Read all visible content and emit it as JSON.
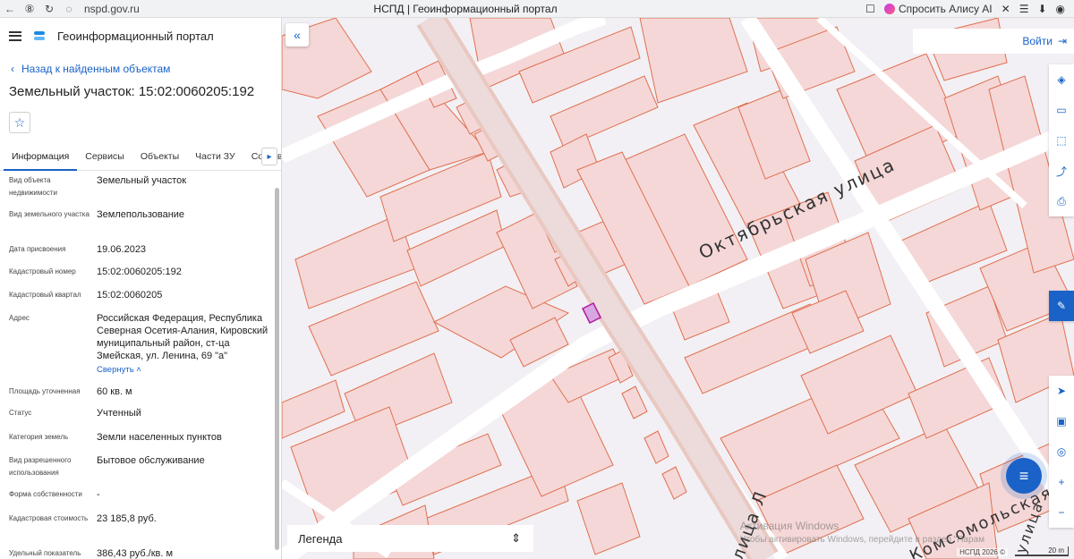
{
  "browser": {
    "url": "nspd.gov.ru",
    "tab_title": "НСПД | Геоинформационный портал",
    "alisa": "Спросить Алису AI"
  },
  "header": {
    "portal_name": "Геоинформационный портал"
  },
  "nav": {
    "back_label": "Назад к найденным объектам"
  },
  "object": {
    "title": "Земельный участок: 15:02:0060205:192"
  },
  "tabs": [
    {
      "label": "Информация",
      "active": true
    },
    {
      "label": "Сервисы",
      "active": false
    },
    {
      "label": "Объекты",
      "active": false
    },
    {
      "label": "Части ЗУ",
      "active": false
    },
    {
      "label": "Состав",
      "active": false
    }
  ],
  "properties": [
    {
      "label": "Вид объекта недвижимости",
      "value": "Земельный участок"
    },
    {
      "label": "Вид земельного участка",
      "value": "Землепользование"
    },
    {
      "label": "Дата присвоения",
      "value": "19.06.2023"
    },
    {
      "label": "Кадастровый номер",
      "value": "15:02:0060205:192"
    },
    {
      "label": "Кадастровый квартал",
      "value": "15:02:0060205"
    },
    {
      "label": "Адрес",
      "value": "Российская Федерация, Республика Северная Осетия-Алания, Кировский муниципальный район, ст-ца Змейская, ул. Ленина, 69 \"а\""
    },
    {
      "label": "Площадь уточненная",
      "value": "60 кв. м"
    },
    {
      "label": "Статус",
      "value": "Учтенный"
    },
    {
      "label": "Категория земель",
      "value": "Земли населенных пунктов"
    },
    {
      "label": "Вид разрешенного использования",
      "value": "Бытовое обслуживание"
    },
    {
      "label": "Форма собственности",
      "value": "-"
    },
    {
      "label": "Кадастровая стоимость",
      "value": "23 185,8 руб."
    },
    {
      "label": "Удельный показатель",
      "value": "386,43 руб./кв. м"
    }
  ],
  "address_toggle": "Свернуть",
  "map": {
    "login_label": "Войти",
    "legend_label": "Легенда",
    "streets": [
      "Октябрьская улица",
      "улица Л",
      "Комсомольская у",
      "улица"
    ],
    "watermark_title": "Активация Windows",
    "watermark_text": "Чтобы активировать Windows, перейдите в раздел \"Парам",
    "attribution": "НСПД 2026 ©",
    "scale_label": "20 m",
    "colors": {
      "parcel_fill": "#f5d7d7",
      "parcel_stroke": "#e07050",
      "selected": "#b01aa0",
      "road": "#ffffff"
    }
  }
}
